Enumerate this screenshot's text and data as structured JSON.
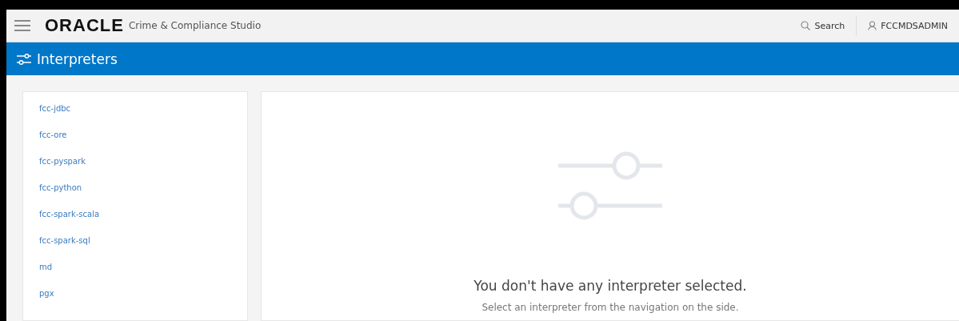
{
  "header": {
    "logo": "ORACLE",
    "product": "Crime & Compliance Studio",
    "search": "Search",
    "user": "FCCMDSADMIN"
  },
  "title_bar": {
    "title": "Interpreters"
  },
  "sidebar": {
    "items": [
      {
        "label": "fcc-jdbc"
      },
      {
        "label": "fcc-ore"
      },
      {
        "label": "fcc-pyspark"
      },
      {
        "label": "fcc-python"
      },
      {
        "label": "fcc-spark-scala"
      },
      {
        "label": "fcc-spark-sql"
      },
      {
        "label": "md"
      },
      {
        "label": "pgx"
      }
    ]
  },
  "empty_state": {
    "heading": "You don't have any interpreter selected.",
    "message": "Select an interpreter from the navigation on the side."
  }
}
